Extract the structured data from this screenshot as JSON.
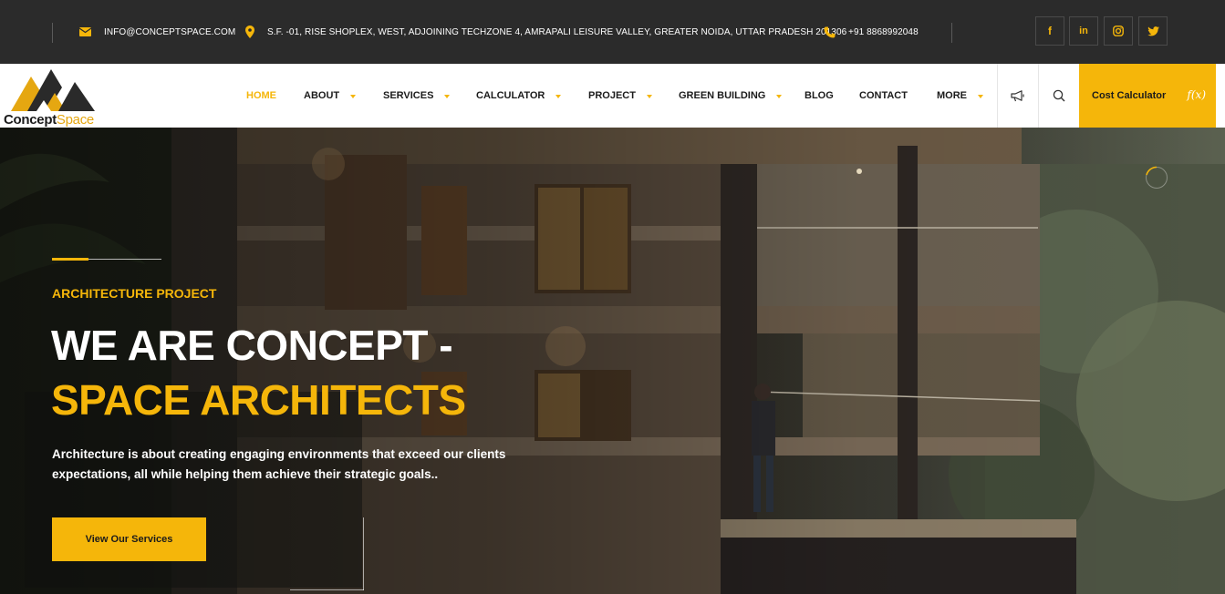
{
  "topbar": {
    "email": "INFO@CONCEPTSPACE.COM",
    "address": "S.F. -01, RISE SHOPLEX, WEST, ADJOINING TECHZONE 4, AMRAPALI LEISURE VALLEY, GREATER NOIDA, UTTAR PRADESH 201306",
    "phone": "+91 8868992048",
    "social": [
      {
        "icon": "facebook-icon",
        "glyph": "f"
      },
      {
        "icon": "linkedin-icon",
        "glyph": "in"
      },
      {
        "icon": "instagram-icon",
        "glyph": ""
      },
      {
        "icon": "twitter-icon",
        "glyph": ""
      }
    ]
  },
  "logo": {
    "part1": "Concept",
    "part2": "Space"
  },
  "nav": {
    "items": [
      {
        "label": "HOME",
        "active": true,
        "dropdown": false
      },
      {
        "label": "ABOUT",
        "active": false,
        "dropdown": true
      },
      {
        "label": "SERVICES",
        "active": false,
        "dropdown": true
      },
      {
        "label": "CALCULATOR",
        "active": false,
        "dropdown": true
      },
      {
        "label": "PROJECT",
        "active": false,
        "dropdown": true
      },
      {
        "label": "GREEN BUILDING",
        "active": false,
        "dropdown": true
      },
      {
        "label": "BLOG",
        "active": false,
        "dropdown": false
      },
      {
        "label": "CONTACT",
        "active": false,
        "dropdown": false
      },
      {
        "label": "MORE",
        "active": false,
        "dropdown": true
      }
    ],
    "calculator_button": "Cost Calculator",
    "calculator_icon": "f(x)"
  },
  "hero": {
    "kicker": "ARCHITECTURE PROJECT",
    "title_line1": "WE ARE CONCEPT -",
    "title_line2": "SPACE ARCHITECTS",
    "description": "Architecture is about creating engaging environments that exceed our clients expectations, all while helping them achieve their strategic goals..",
    "cta_label": "View Our Services"
  },
  "colors": {
    "accent": "#f5b60a",
    "topbar": "#2b2b2b",
    "nav_bg": "#ffffff"
  }
}
